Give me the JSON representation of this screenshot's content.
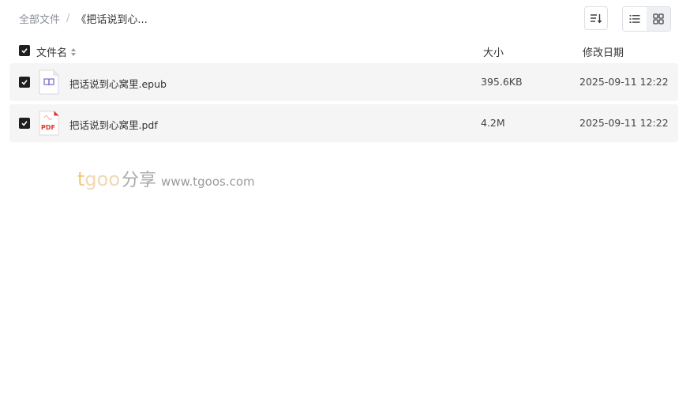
{
  "breadcrumb": {
    "root": "全部文件",
    "separator": "/",
    "current": "《把话说到心..."
  },
  "toolbar": {
    "sort_icon": "sort-lines-icon",
    "list_view_icon": "list-icon",
    "grid_view_icon": "grid-icon",
    "active_view": "grid"
  },
  "table": {
    "header": {
      "name": "文件名",
      "size": "大小",
      "date": "修改日期"
    },
    "rows": [
      {
        "name": "把话说到心窝里.epub",
        "size": "395.6KB",
        "date": "2025-09-11 12:22",
        "icon": "epub-file-icon",
        "checked": true
      },
      {
        "name": "把话说到心窝里.pdf",
        "size": "4.2M",
        "date": "2025-09-11 12:22",
        "icon": "pdf-file-icon",
        "checked": true
      }
    ]
  },
  "watermark": {
    "brand_t": "t",
    "brand_goo": "goo",
    "brand_cn": "分享",
    "url": "www.tgoos.com"
  },
  "colors": {
    "row_background": "#f5f5f5",
    "checkbox": "#1f1f1f",
    "pdf_red": "#e0352b",
    "epub_purple": "#7b6fd6"
  }
}
